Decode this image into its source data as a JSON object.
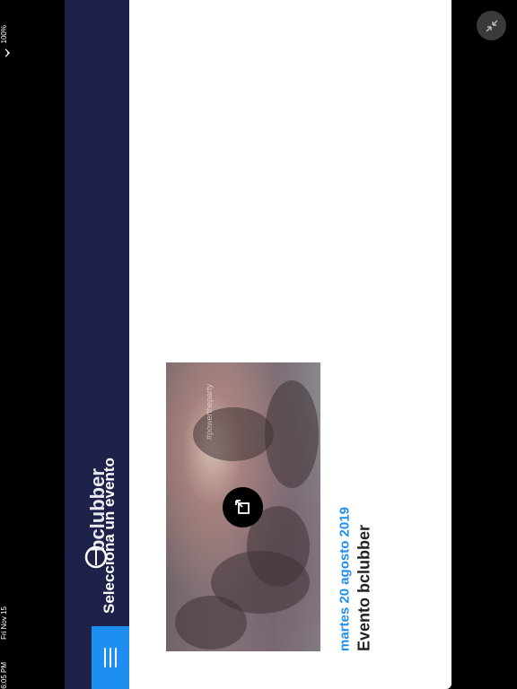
{
  "status_bar": {
    "time": "6:05 PM",
    "date": "Fri Nov 15",
    "battery": "100%",
    "wifi_icon": "wifi-icon"
  },
  "nav": {
    "title": "Selecciona un evento",
    "menu_icon": "hamburger-icon",
    "menu_color": "#1e8ef0",
    "bar_color": "#1e2149"
  },
  "event": {
    "date": "martes 20 agosto 2019",
    "name": "Evento bclubber",
    "image": {
      "logo_text": "bclubber",
      "hashtag": "#powertheparty"
    },
    "open_icon": "open-external-icon",
    "date_color": "#1e8ef0"
  },
  "window_controls": {
    "collapse_icon": "collapse-icon"
  }
}
